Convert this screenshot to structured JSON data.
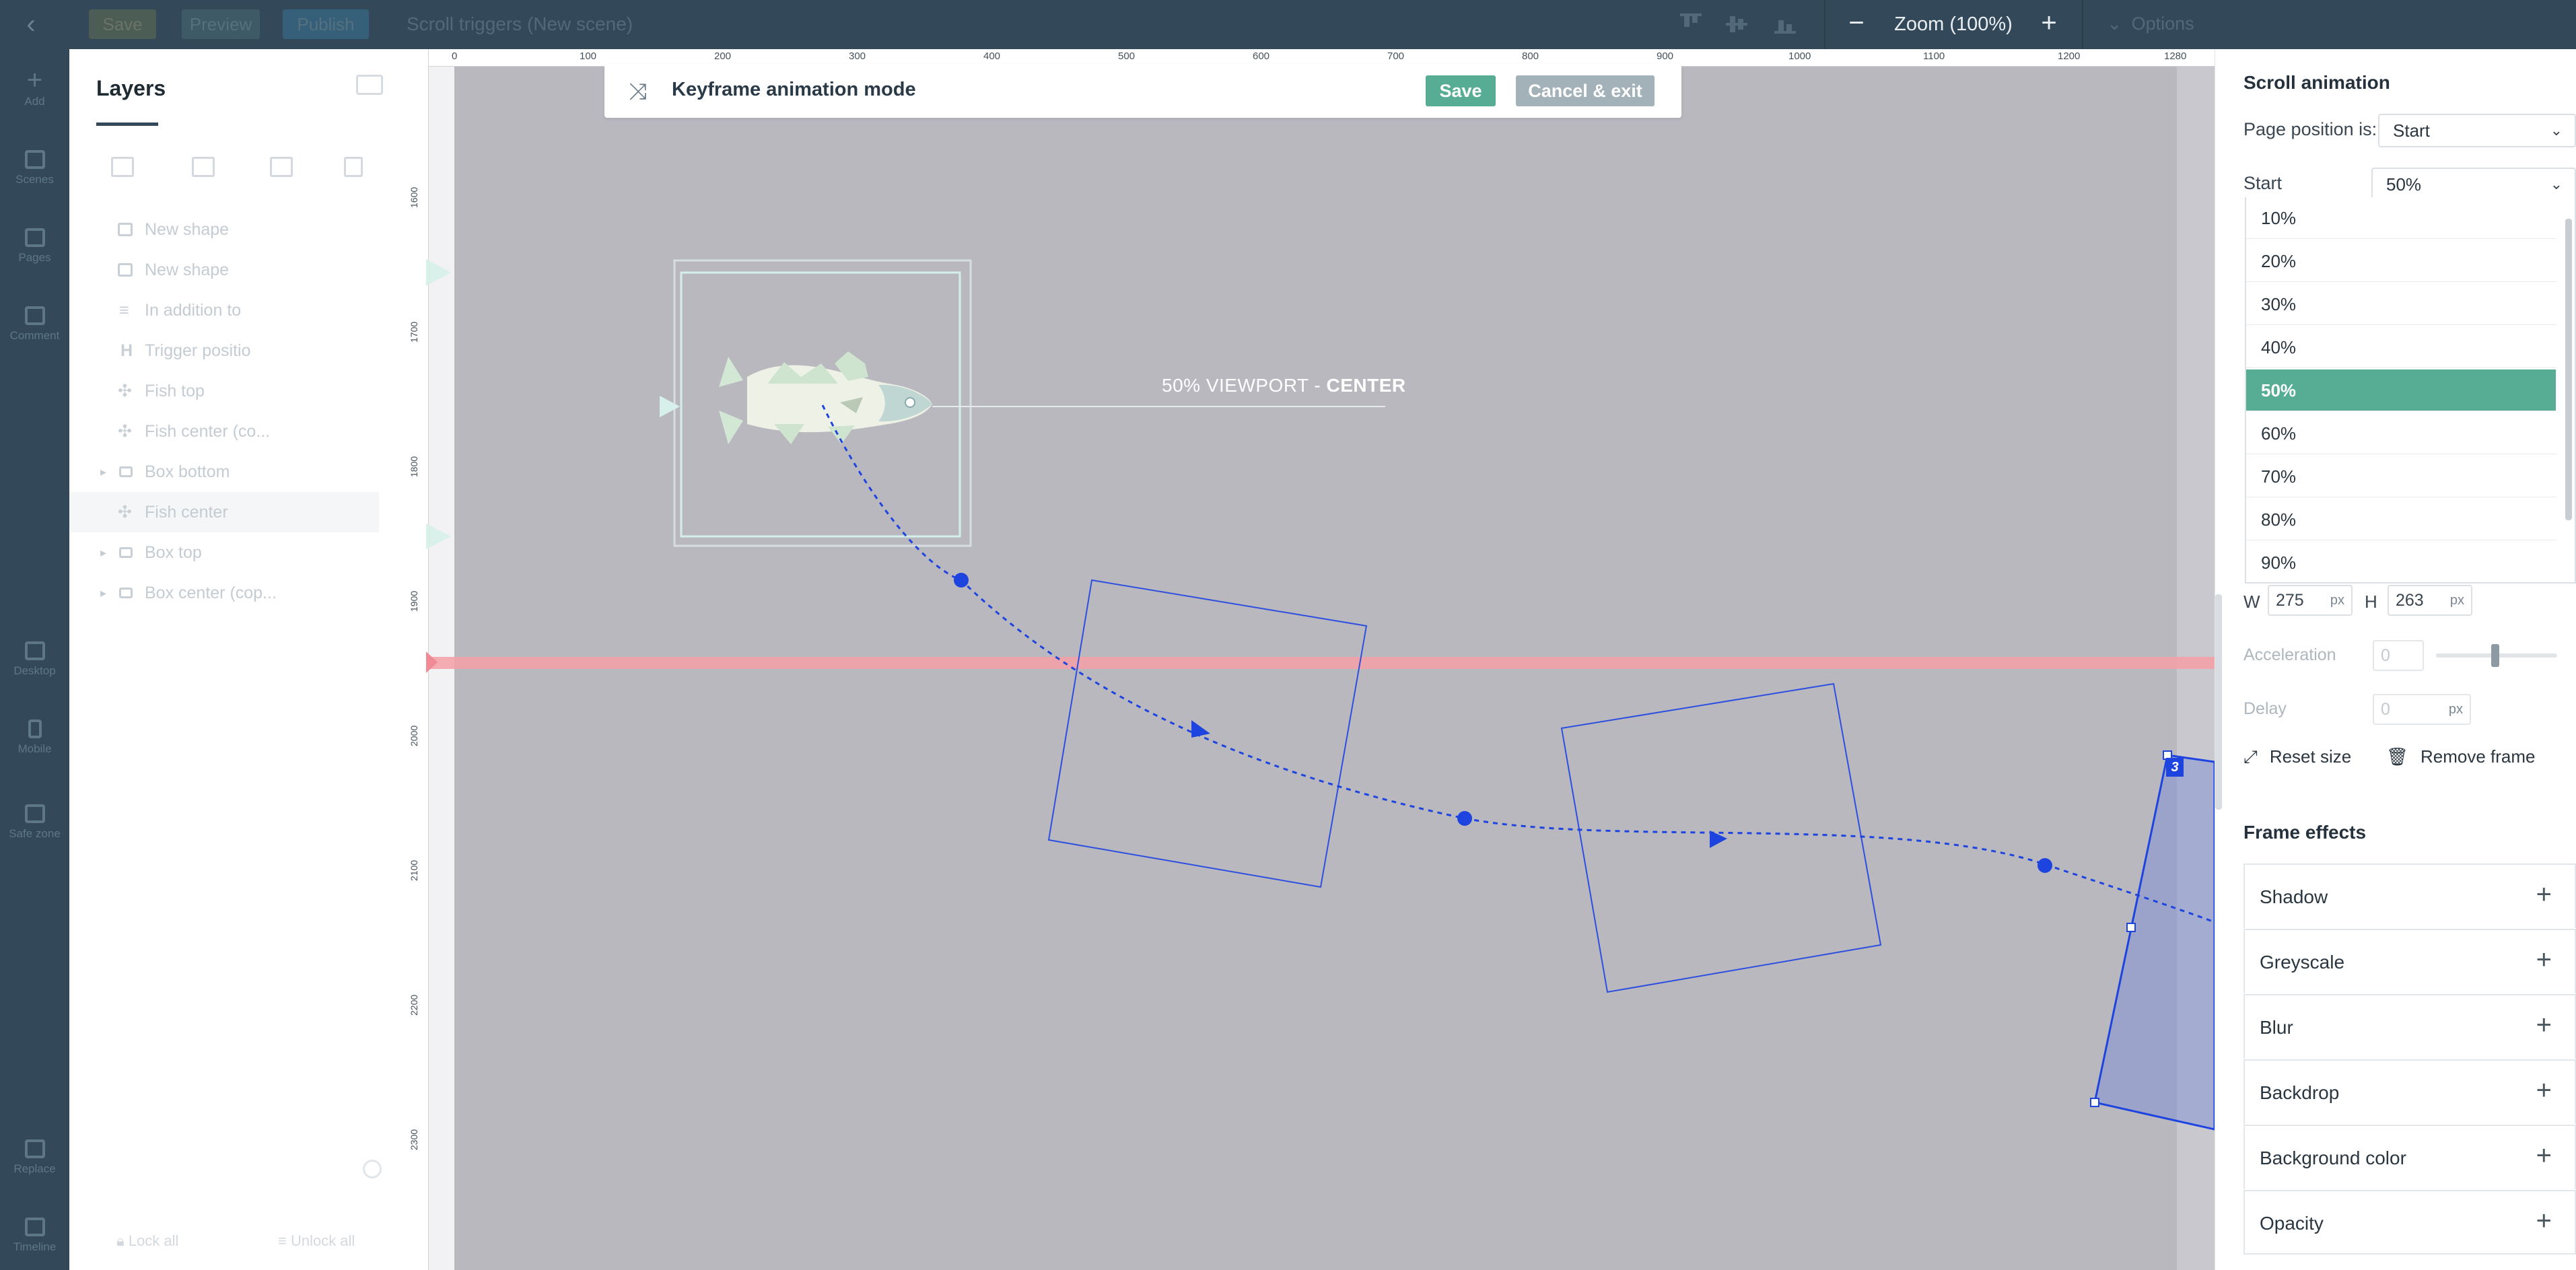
{
  "topbar": {
    "save": "Save",
    "preview": "Preview",
    "publish": "Publish",
    "scene_title": "Scroll triggers (New scene)",
    "zoom": "Zoom (100%)",
    "zoom_minus": "−",
    "zoom_plus": "+",
    "options": "Options"
  },
  "rail": {
    "items": [
      "Add",
      "Scenes",
      "Pages",
      "Comment",
      "Desktop",
      "Mobile",
      "Safe zone",
      "Replace",
      "Timeline"
    ]
  },
  "layers": {
    "title": "Layers",
    "items": [
      {
        "label": "New shape",
        "icon": "rect-icon",
        "caret": false
      },
      {
        "label": "New shape",
        "icon": "rect-icon",
        "caret": false
      },
      {
        "label": "In addition to",
        "icon": "text-icon",
        "caret": false
      },
      {
        "label": "Trigger positio",
        "icon": "heading-icon",
        "caret": false
      },
      {
        "label": "Fish top",
        "icon": "puzzle-icon",
        "caret": false
      },
      {
        "label": "Fish center (co...",
        "icon": "puzzle-icon",
        "caret": false
      },
      {
        "label": "Box bottom",
        "icon": "folder-icon",
        "caret": true
      },
      {
        "label": "Fish center",
        "icon": "puzzle-icon",
        "caret": false
      },
      {
        "label": "Box top",
        "icon": "folder-icon",
        "caret": true
      },
      {
        "label": "Box center (cop...",
        "icon": "folder-icon",
        "caret": true
      }
    ],
    "lock_all": "Lock all",
    "unlock_all": "Unlock all"
  },
  "ruler": {
    "top": [
      "0",
      "100",
      "200",
      "300",
      "400",
      "500",
      "600",
      "700",
      "800",
      "900",
      "1000",
      "1100",
      "1200",
      "1280"
    ],
    "left": [
      "1600",
      "1700",
      "1800",
      "1900",
      "2000",
      "2100",
      "2200",
      "2300"
    ]
  },
  "keyframe_banner": {
    "title": "Keyframe animation mode",
    "save": "Save",
    "cancel": "Cancel & exit"
  },
  "canvas": {
    "viewport_label_prefix": "50% VIEWPORT - ",
    "viewport_label_strong": "CENTER",
    "keyframe_number": "3"
  },
  "panel": {
    "title": "Scroll animation",
    "page_position_label": "Page position is:",
    "page_position_value": "Start",
    "start_label": "Start",
    "start_value": "50%",
    "start_options": [
      "10%",
      "20%",
      "30%",
      "40%",
      "50%",
      "60%",
      "70%",
      "80%",
      "90%"
    ],
    "start_selected": "50%",
    "w_label": "W",
    "w_value": "275",
    "h_label": "H",
    "h_value": "263",
    "unit_px": "px",
    "acceleration_label": "Acceleration",
    "acceleration_value": "0",
    "delay_label": "Delay",
    "delay_value": "0",
    "reset_size": "Reset size",
    "remove_frame": "Remove frame",
    "frame_effects_title": "Frame effects",
    "effects": [
      "Shadow",
      "Greyscale",
      "Blur",
      "Backdrop",
      "Background color",
      "Opacity"
    ]
  },
  "colors": {
    "topbar": "#33495a",
    "accent_green": "#56ad93",
    "path_blue": "#1e44e0",
    "trigger_line": "#f4a0a6",
    "canvas_bg": "#b9b8bf"
  }
}
